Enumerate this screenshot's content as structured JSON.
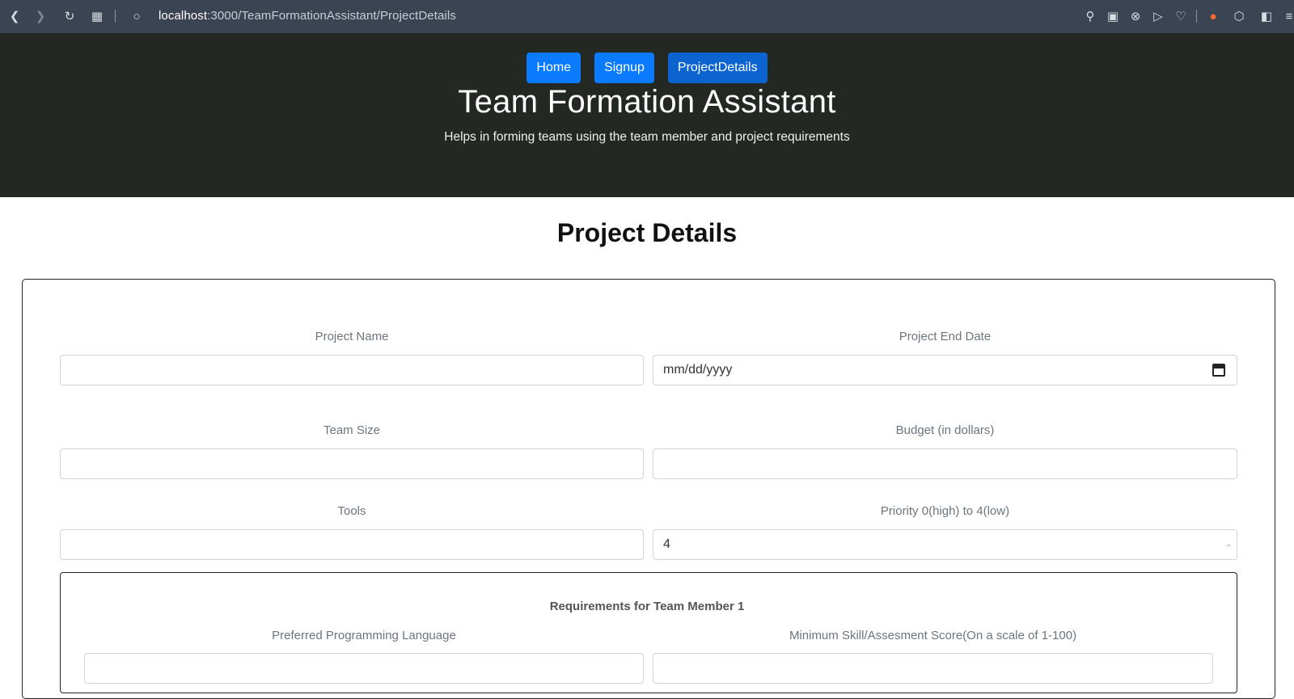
{
  "browser": {
    "url_host": "localhost",
    "url_rest": ":3000/TeamFormationAssistant/ProjectDetails"
  },
  "nav": {
    "buttons": [
      {
        "label": "Home"
      },
      {
        "label": "Signup"
      },
      {
        "label": "ProjectDetails"
      }
    ]
  },
  "header": {
    "title": "Team Formation Assistant",
    "lead": "Helps in forming teams using the team member and project requirements"
  },
  "page": {
    "title": "Project Details"
  },
  "form": {
    "project_name": {
      "label": "Project Name",
      "value": ""
    },
    "end_date": {
      "label": "Project End Date",
      "placeholder": "mm/dd/yyyy"
    },
    "team_size": {
      "label": "Team Size",
      "value": ""
    },
    "budget": {
      "label": "Budget (in dollars)",
      "value": ""
    },
    "tools": {
      "label": "Tools",
      "value": ""
    },
    "priority": {
      "label": "Priority 0(high) to 4(low)",
      "value": "4"
    },
    "member": {
      "title": "Requirements for Team Member 1",
      "language_label": "Preferred Programming Language",
      "score_label": "Minimum Skill/Assesment Score(On a scale of 1-100)"
    }
  }
}
